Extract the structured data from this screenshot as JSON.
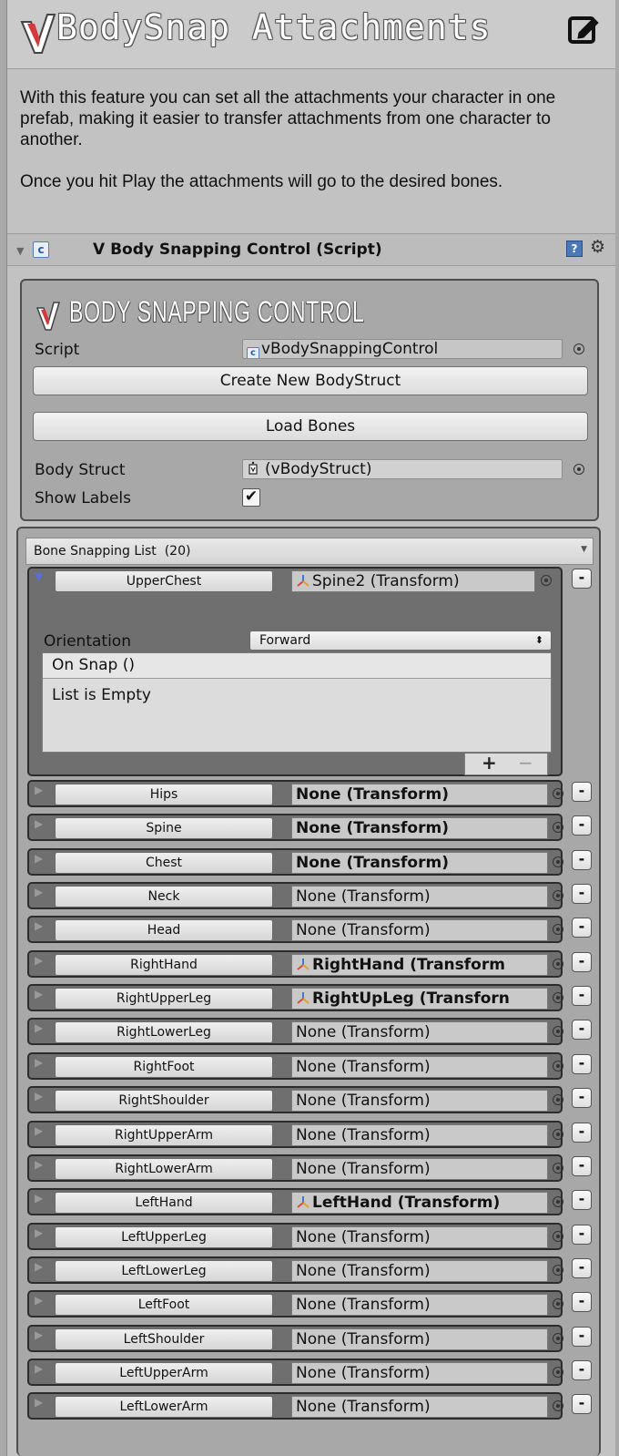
{
  "header": {
    "title": "BodySnap Attachments"
  },
  "description": {
    "paragraph1": "With this feature you can set all the attachments your character in one prefab, making it easier to transfer attachments from one character to another.",
    "paragraph2": "Once you hit Play the attachments will go to the desired bones."
  },
  "component": {
    "title": "V Body Snapping Control (Script)",
    "help_glyph": "?",
    "script_glyph": "c"
  },
  "panel": {
    "title": "BODY SNAPPING CONTROL",
    "script_label": "Script",
    "script_value": "vBodySnappingControl",
    "create_button": "Create New BodyStruct",
    "load_button": "Load Bones",
    "body_struct_label": "Body Struct",
    "body_struct_value": "(vBodyStruct)",
    "show_labels_label": "Show Labels",
    "show_labels_checked": true,
    "checkmark": "✔"
  },
  "bone_list": {
    "header": "Bone Snapping List",
    "count": "(20)",
    "expanded": {
      "name": "UpperChest",
      "target": "Spine2 (Transform)",
      "orientation_label": "Orientation",
      "orientation_value": "Forward",
      "event_header": "On Snap ()",
      "event_empty": "List is Empty",
      "plus": "+",
      "minus": "−"
    },
    "rows": [
      {
        "name": "Hips",
        "target": "None (Transform)",
        "bold": true,
        "icon": false
      },
      {
        "name": "Spine",
        "target": "None (Transform)",
        "bold": true,
        "icon": false
      },
      {
        "name": "Chest",
        "target": "None (Transform)",
        "bold": true,
        "icon": false
      },
      {
        "name": "Neck",
        "target": "None (Transform)",
        "bold": false,
        "icon": false
      },
      {
        "name": "Head",
        "target": "None (Transform)",
        "bold": false,
        "icon": false
      },
      {
        "name": "RightHand",
        "target": "RightHand (Transform",
        "bold": true,
        "icon": true
      },
      {
        "name": "RightUpperLeg",
        "target": "RightUpLeg (Transforn",
        "bold": true,
        "icon": true
      },
      {
        "name": "RightLowerLeg",
        "target": "None (Transform)",
        "bold": false,
        "icon": false
      },
      {
        "name": "RightFoot",
        "target": "None (Transform)",
        "bold": false,
        "icon": false
      },
      {
        "name": "RightShoulder",
        "target": "None (Transform)",
        "bold": false,
        "icon": false
      },
      {
        "name": "RightUpperArm",
        "target": "None (Transform)",
        "bold": false,
        "icon": false
      },
      {
        "name": "RightLowerArm",
        "target": "None (Transform)",
        "bold": false,
        "icon": false
      },
      {
        "name": "LeftHand",
        "target": "LeftHand (Transform)",
        "bold": true,
        "icon": true
      },
      {
        "name": "LeftUpperLeg",
        "target": "None (Transform)",
        "bold": false,
        "icon": false
      },
      {
        "name": "LeftLowerLeg",
        "target": "None (Transform)",
        "bold": false,
        "icon": false
      },
      {
        "name": "LeftFoot",
        "target": "None (Transform)",
        "bold": false,
        "icon": false
      },
      {
        "name": "LeftShoulder",
        "target": "None (Transform)",
        "bold": false,
        "icon": false
      },
      {
        "name": "LeftUpperArm",
        "target": "None (Transform)",
        "bold": false,
        "icon": false
      },
      {
        "name": "LeftLowerArm",
        "target": "None (Transform)",
        "bold": false,
        "icon": false
      }
    ],
    "remove_glyph": "-"
  },
  "colors": {
    "background": "#c2c2c2",
    "panel": "#a8a8a8",
    "row": "#6f6f6f",
    "accent_blue": "#5a6fd6"
  }
}
